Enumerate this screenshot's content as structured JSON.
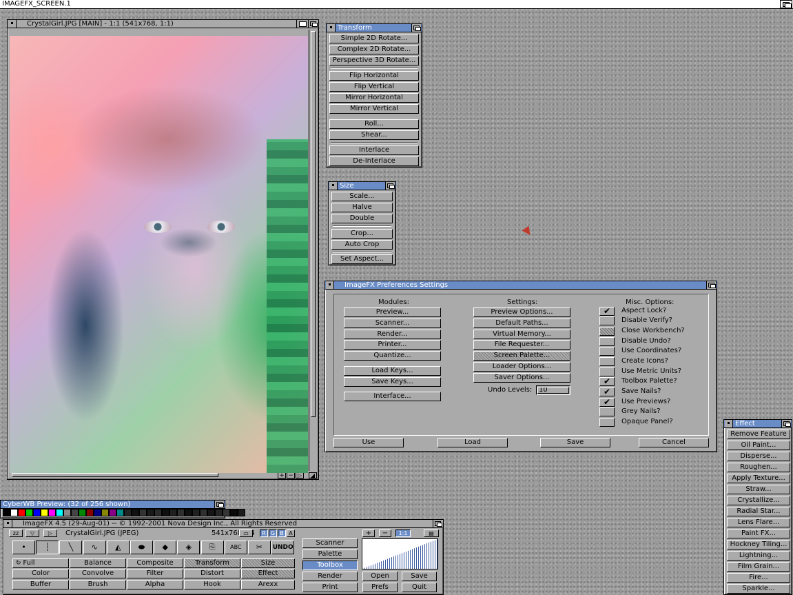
{
  "screen": {
    "title": "IMAGEFX_SCREEN.1"
  },
  "main_window": {
    "title": "CrystalGirl.JPG [MAIN] - 1:1 (541x768, 1:1)"
  },
  "transform_panel": {
    "title": "Transform",
    "items": [
      "Simple 2D Rotate...",
      "Complex 2D Rotate...",
      "Perspective 3D Rotate...",
      "Flip Horizontal",
      "Flip Vertical",
      "Mirror Horizontal",
      "Mirror Vertical",
      "Roll...",
      "Shear...",
      "Interlace",
      "De-Interlace"
    ]
  },
  "size_panel": {
    "title": "Size",
    "items": [
      "Scale...",
      "Halve",
      "Double",
      "Crop...",
      "Auto Crop",
      "Set Aspect..."
    ]
  },
  "prefs": {
    "title": "ImageFX Preferences Settings",
    "modules_heading": "Modules:",
    "modules": [
      "Preview...",
      "Scanner...",
      "Render...",
      "Printer...",
      "Quantize...",
      "Load Keys...",
      "Save Keys...",
      "Interface..."
    ],
    "settings_heading": "Settings:",
    "settings": [
      "Preview Options...",
      "Default Paths...",
      "Virtual Memory...",
      "File Requester...",
      "Screen Palette...",
      "Loader Options...",
      "Saver Options..."
    ],
    "undo_label": "Undo Levels:",
    "undo_value": "10",
    "misc_heading": "Misc. Options:",
    "options": [
      {
        "label": "Aspect Lock?",
        "checked": "✔"
      },
      {
        "label": "Disable Verify?",
        "checked": ""
      },
      {
        "label": "Close Workbench?",
        "checked": ""
      },
      {
        "label": "Disable Undo?",
        "checked": ""
      },
      {
        "label": "Use Coordinates?",
        "checked": ""
      },
      {
        "label": "Create Icons?",
        "checked": ""
      },
      {
        "label": "Use Metric Units?",
        "checked": ""
      },
      {
        "label": "Toolbox Palette?",
        "checked": "✔"
      },
      {
        "label": "Save Nails?",
        "checked": "✔"
      },
      {
        "label": "Use Previews?",
        "checked": "✔"
      },
      {
        "label": "Grey Nails?",
        "checked": ""
      },
      {
        "label": "Opaque Panel?",
        "checked": ""
      }
    ],
    "use_label": "Use",
    "load_label": "Load",
    "save_label": "Save",
    "cancel_label": "Cancel"
  },
  "effect_panel": {
    "title": "Effect",
    "items": [
      "Remove Feature",
      "Oil Paint...",
      "Disperse...",
      "Roughen...",
      "Apply Texture...",
      "Straw...",
      "Crystallize...",
      "Radial Star...",
      "Lens Flare...",
      "Paint FX...",
      "Hockney Tiling...",
      "Lightning...",
      "Film Grain...",
      "Fire...",
      "Sparkle..."
    ]
  },
  "cyberwb": {
    "title": "CyberWB Preview: (32 of 256 shown)",
    "colors": [
      "#000000",
      "#ffffff",
      "#ff0000",
      "#00cc00",
      "#0000ff",
      "#ffff00",
      "#ff00ff",
      "#00ffff",
      "#888888",
      "#444444",
      "#008800",
      "#880000",
      "#000088",
      "#888800",
      "#880088",
      "#008888",
      "#222222",
      "#111111",
      "#333333",
      "#1a1a1a",
      "#2a2a2a",
      "#0f0f0f",
      "#1f1f1f",
      "#2f2f2f",
      "#101010",
      "#202020",
      "#303030",
      "#151515",
      "#252525",
      "#353535",
      "#0a0a0a",
      "#1c1c1c"
    ]
  },
  "toolbox": {
    "title": "ImageFX 4.5  (29-Aug-01) -- © 1992-2001 Nova Design Inc., All Rights Reserved",
    "buffer_name": "CrystalGirl.JPG (JPEG)",
    "buffer_size": "541x768x24",
    "zz": "zz",
    "channels": [
      "R",
      "G",
      "B",
      "A"
    ],
    "tools": [
      "•",
      "┆",
      "╲",
      "∿",
      "◭",
      "⬬",
      "◆",
      "◈",
      "⎘",
      "ABC",
      "✂",
      "UNDO"
    ],
    "grid": [
      [
        "Full",
        "Balance",
        "Composite",
        "Transform",
        "Size"
      ],
      [
        "Color",
        "Convolve",
        "Filter",
        "Distort",
        "Effect"
      ],
      [
        "Buffer",
        "Brush",
        "Alpha",
        "Hook",
        "Arexx"
      ]
    ],
    "side_buttons": [
      "Scanner",
      "Palette",
      "Toolbox",
      "Render",
      "Print"
    ],
    "zoom_plus": "+",
    "zoom_minus": "−",
    "zoom_ratio": "1:1",
    "open_label": "Open",
    "save_label": "Save",
    "prefs_label": "Prefs",
    "quit_label": "Quit"
  }
}
